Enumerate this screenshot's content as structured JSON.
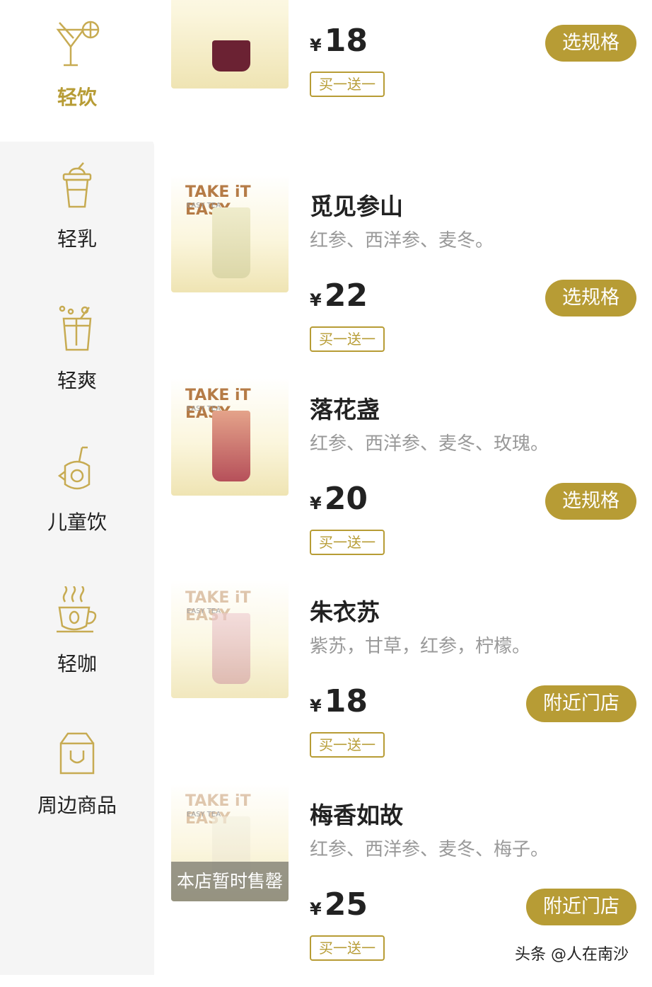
{
  "sidebar": {
    "items": [
      {
        "label": "轻饮",
        "icon": "cocktail-icon",
        "active": true
      },
      {
        "label": "轻乳",
        "icon": "milk-cup-icon",
        "active": false
      },
      {
        "label": "轻爽",
        "icon": "fizzy-drink-icon",
        "active": false
      },
      {
        "label": "儿童饮",
        "icon": "kids-drink-icon",
        "active": false
      },
      {
        "label": "轻咖",
        "icon": "coffee-cup-icon",
        "active": false
      },
      {
        "label": "周边商品",
        "icon": "shopping-bag-icon",
        "active": false
      }
    ]
  },
  "section": {
    "title": "轻饮"
  },
  "products": [
    {
      "name": "",
      "desc": "",
      "currency": "¥",
      "price": "18",
      "promo": "买一送一",
      "action": "选规格",
      "overlay": ""
    },
    {
      "name": "觅见参山",
      "desc": "红参、西洋参、麦冬。",
      "currency": "¥",
      "price": "22",
      "promo": "买一送一",
      "action": "选规格",
      "overlay": ""
    },
    {
      "name": "落花盏",
      "desc": "红参、西洋参、麦冬、玫瑰。",
      "currency": "¥",
      "price": "20",
      "promo": "买一送一",
      "action": "选规格",
      "overlay": ""
    },
    {
      "name": "朱衣苏",
      "desc": "紫苏，甘草，红参，柠檬。",
      "currency": "¥",
      "price": "18",
      "promo": "买一送一",
      "action": "附近门店",
      "overlay": ""
    },
    {
      "name": "梅香如故",
      "desc": "红参、西洋参、麦冬、梅子。",
      "currency": "¥",
      "price": "25",
      "promo": "买一送一",
      "action": "附近门店",
      "overlay": "本店暂时售罄"
    }
  ],
  "thumb": {
    "brand": "TAKE iT EASY",
    "sub": "EASY TEA"
  },
  "watermark": "头条 @人在南沙",
  "colors": {
    "accent": "#b79c35",
    "sidebar_bg": "#f5f5f5"
  }
}
